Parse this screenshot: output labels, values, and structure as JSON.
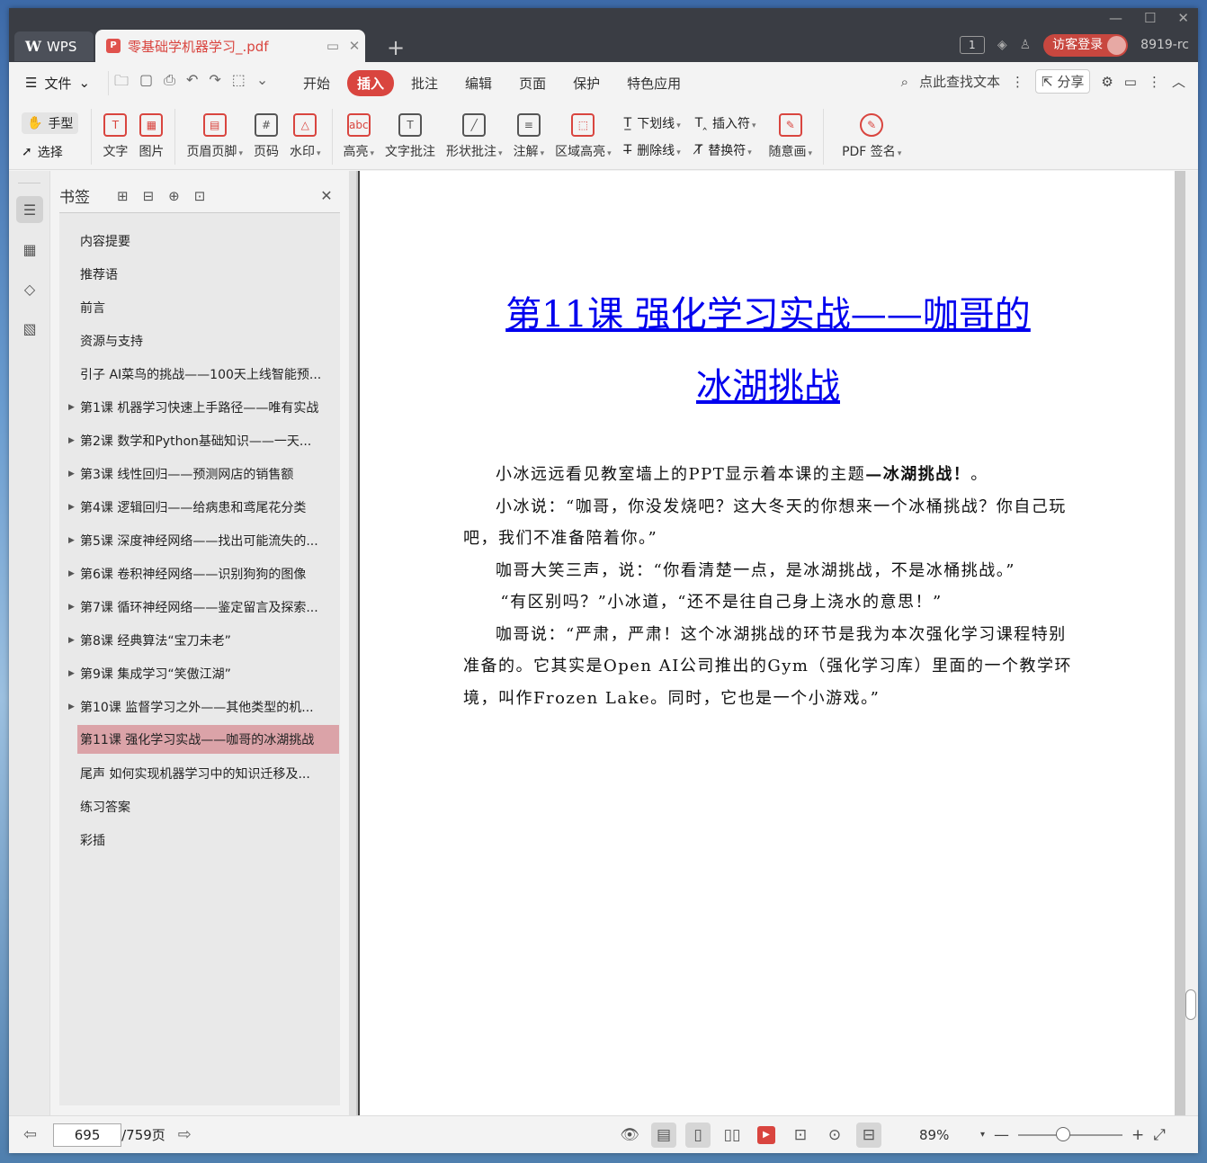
{
  "tabs": {
    "app_label": "WPS",
    "doc_name": "零基础学机器学习_.pdf",
    "badge_num": "1",
    "login": "访客登录",
    "version": "8919-rc"
  },
  "menu": {
    "file": "文件",
    "items": [
      "开始",
      "插入",
      "批注",
      "编辑",
      "页面",
      "保护",
      "特色应用"
    ],
    "search": "点此查找文本",
    "share": "分享"
  },
  "ribbon": {
    "hand": "手型",
    "select": "选择",
    "text": "文字",
    "image": "图片",
    "header_footer": "页眉页脚",
    "page_number": "页码",
    "watermark": "水印",
    "highlight": "高亮",
    "text_annot": "文字批注",
    "shape_annot": "形状批注",
    "note": "注解",
    "area_highlight": "区域高亮",
    "underline": "下划线",
    "strikethrough": "删除线",
    "insert_mark": "插入符",
    "replace_mark": "替换符",
    "freehand": "随意画",
    "pdf_sign": "PDF 签名"
  },
  "bookmarks": {
    "title": "书签",
    "items": [
      "内容提要",
      "推荐语",
      "前言",
      "资源与支持",
      "引子 AI菜鸟的挑战——100天上线智能预...",
      "第1课 机器学习快速上手路径——唯有实战",
      "第2课 数学和Python基础知识——一天...",
      "第3课 线性回归——预测网店的销售额",
      "第4课 逻辑回归——给病患和鸢尾花分类",
      "第5课 深度神经网络——找出可能流失的...",
      "第6课 卷积神经网络——识别狗狗的图像",
      "第7课 循环神经网络——鉴定留言及探索...",
      "第8课 经典算法“宝刀未老”",
      "第9课 集成学习“笑傲江湖”",
      "第10课 监督学习之外——其他类型的机...",
      "第11课 强化学习实战——咖哥的冰湖挑战",
      "尾声 如何实现机器学习中的知识迁移及...",
      "练习答案",
      "彩插"
    ]
  },
  "document": {
    "title_line1": "第11课 强化学习实战——咖哥的",
    "title_line2": "冰湖挑战",
    "p1_plain": "小冰远远看见教室墙上的PPT显示着本课的主题",
    "p1_bold": "—冰湖挑战！",
    "p1_tail": "。",
    "p2": "小冰说：“咖哥，你没发烧吧？这大冬天的你想来一个冰桶挑战？你自己玩吧，我们不准备陪着你。”",
    "p3": "咖哥大笑三声，说：“你看清楚一点，是冰湖挑战，不是冰桶挑战。”",
    "p4": "“有区别吗？”小冰道，“还不是往自己身上浇水的意思！”",
    "p5": "咖哥说：“严肃，严肃！这个冰湖挑战的环节是我为本次强化学习课程特别准备的。它其实是Open AI公司推出的Gym（强化学习库）里面的一个教学环境，叫作Frozen Lake。同时，它也是一个小游戏。”"
  },
  "status": {
    "current_page": "695",
    "total_pages": "/759页",
    "zoom": "89%"
  }
}
